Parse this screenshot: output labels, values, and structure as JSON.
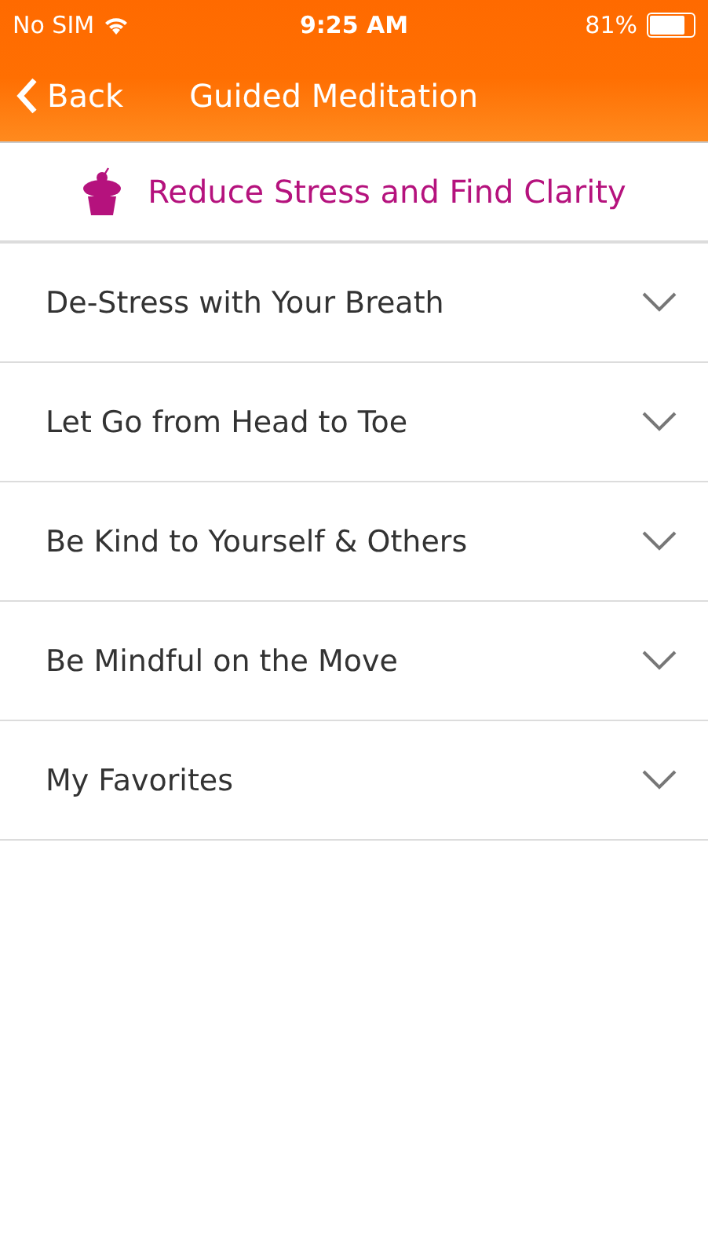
{
  "status_bar": {
    "carrier": "No SIM",
    "time": "9:25 AM",
    "battery": "81%"
  },
  "nav_bar": {
    "back": "Back",
    "title": "Guided Meditation"
  },
  "header": {
    "title": "Reduce Stress and Find Clarity"
  },
  "sections": [
    {
      "label": "De-Stress with Your Breath",
      "expanded": false
    },
    {
      "label": "Let Go from Head to Toe",
      "expanded": false
    },
    {
      "label": "Be Kind to Yourself & Others",
      "expanded": false
    },
    {
      "label": "Be Mindful on the Move",
      "expanded": false
    },
    {
      "label": "My Favorites",
      "expanded": false
    }
  ]
}
